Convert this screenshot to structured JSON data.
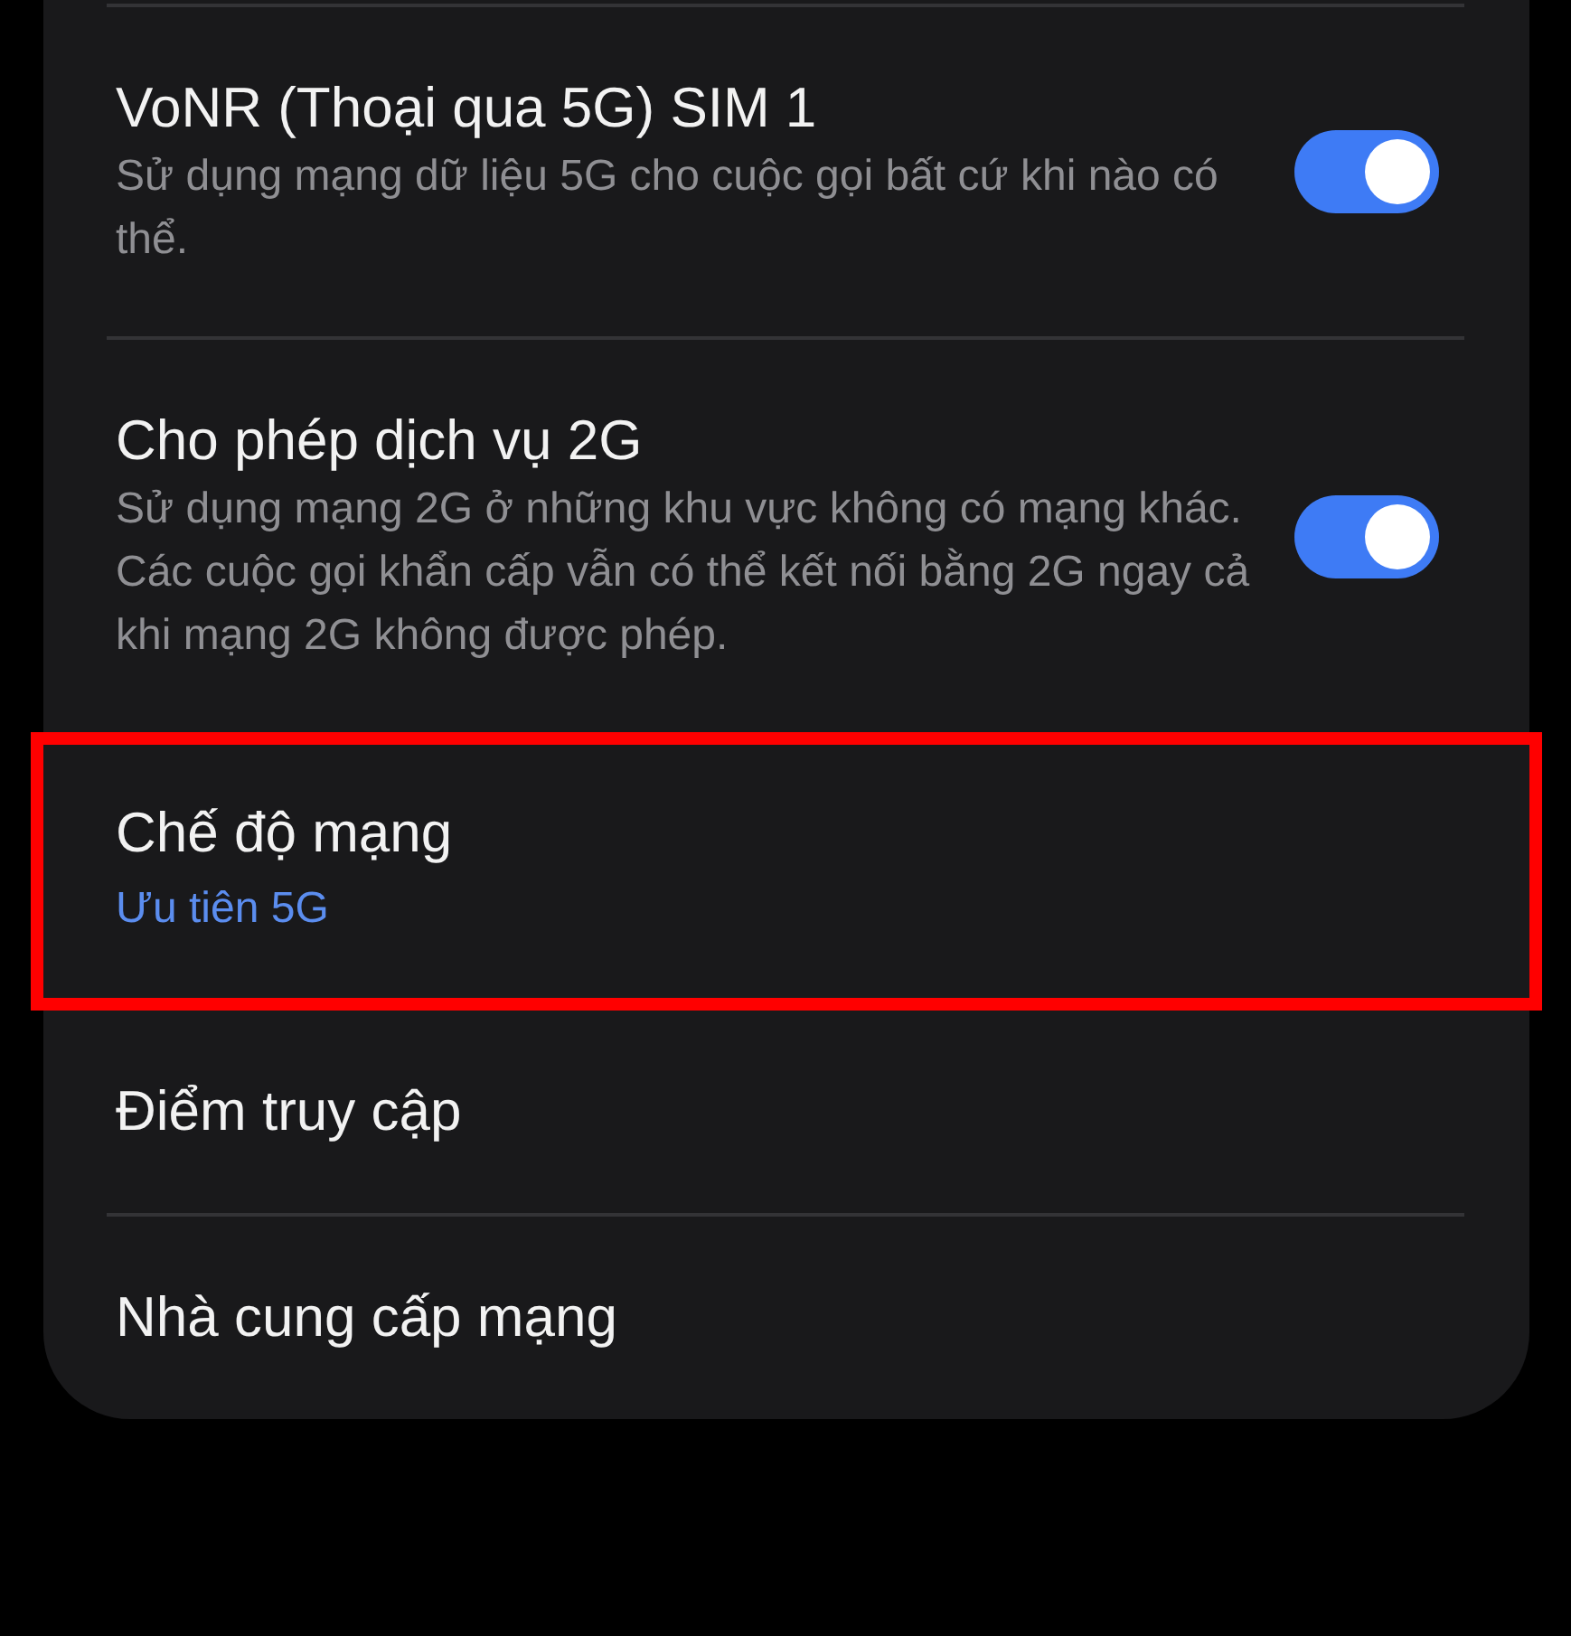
{
  "settings": [
    {
      "kind": "switch",
      "title": "VoNR (Thoại qua 5G) SIM 1",
      "description": "Sử dụng mạng dữ liệu 5G cho cuộc gọi bất cứ khi nào có thể.",
      "on": true,
      "highlighted": false
    },
    {
      "kind": "switch",
      "title": "Cho phép dịch vụ 2G",
      "description": "Sử dụng mạng 2G ở những khu vực không có mạng khác. Các cuộc gọi khẩn cấp vẫn có thể kết nối bằng 2G ngay cả khi mạng 2G không được phép.",
      "on": true,
      "highlighted": false
    },
    {
      "kind": "value",
      "title": "Chế độ mạng",
      "value": "Ưu tiên 5G",
      "highlighted": true
    },
    {
      "kind": "link",
      "title": "Điểm truy cập",
      "highlighted": false
    },
    {
      "kind": "link",
      "title": "Nhà cung cấp mạng",
      "highlighted": false
    }
  ]
}
